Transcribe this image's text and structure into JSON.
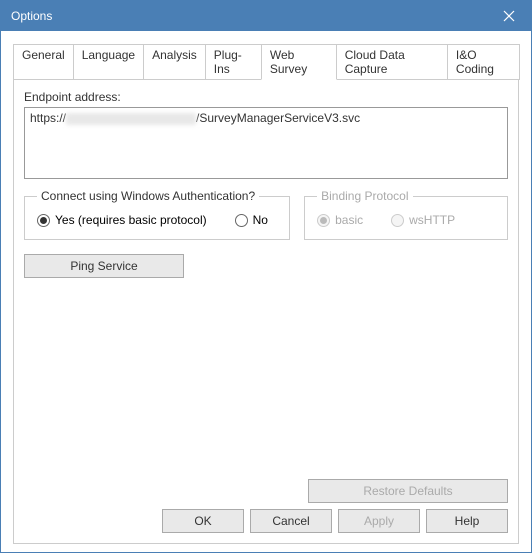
{
  "window": {
    "title": "Options"
  },
  "tabs": [
    {
      "label": "General",
      "active": false
    },
    {
      "label": "Language",
      "active": false
    },
    {
      "label": "Analysis",
      "active": false
    },
    {
      "label": "Plug-Ins",
      "active": false
    },
    {
      "label": "Web Survey",
      "active": true
    },
    {
      "label": "Cloud Data Capture",
      "active": false
    },
    {
      "label": "I&O Coding",
      "active": false
    }
  ],
  "endpoint": {
    "label": "Endpoint address:",
    "value_prefix": "https://",
    "value_suffix": "/SurveyManagerServiceV3.svc"
  },
  "auth": {
    "legend": "Connect using Windows Authentication?",
    "options": {
      "yes": "Yes (requires basic protocol)",
      "no": "No"
    },
    "selected": "yes"
  },
  "binding": {
    "legend": "Binding Protocol",
    "options": {
      "basic": "basic",
      "wshttp": "wsHTTP"
    },
    "selected": "basic",
    "disabled": true
  },
  "buttons": {
    "ping": "Ping Service",
    "restore": "Restore Defaults",
    "ok": "OK",
    "cancel": "Cancel",
    "apply": "Apply",
    "help": "Help"
  }
}
